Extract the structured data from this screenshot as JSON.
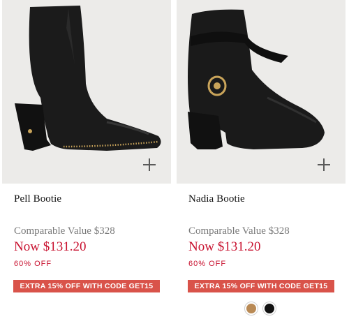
{
  "products": [
    {
      "name": "Pell Bootie",
      "comparable": "Comparable Value $328",
      "price": "Now $131.20",
      "discount": "60% OFF",
      "promo": "EXTRA 15% OFF WITH CODE GET15",
      "icon": "plus-icon"
    },
    {
      "name": "Nadia Bootie",
      "comparable": "Comparable Value $328",
      "price": "Now $131.20",
      "discount": "60% OFF",
      "promo": "EXTRA 15% OFF WITH CODE GET15",
      "icon": "plus-icon",
      "swatches": [
        "#b98a55",
        "#111111"
      ]
    }
  ],
  "colors": {
    "price_red": "#c8102e",
    "promo_bg": "#d9534a",
    "image_bg": "#ecebe9"
  }
}
